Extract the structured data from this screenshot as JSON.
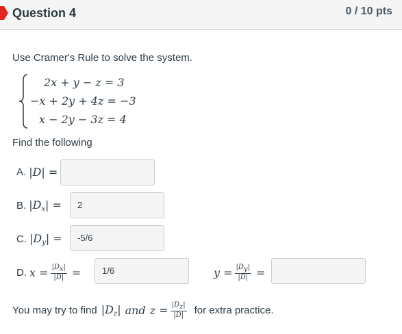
{
  "header": {
    "title": "Question 4",
    "points": "0 / 10 pts"
  },
  "prompt": "Use Cramer's Rule to solve the system.",
  "system": {
    "eq1": "2x + y − z = 3",
    "eq2": "−x + 2y + 4z = −3",
    "eq3": "x − 2y − 3z = 4"
  },
  "find_label": "Find the following",
  "answers": {
    "a": {
      "letter": "A.",
      "value": ""
    },
    "b": {
      "letter": "B.",
      "value": "2"
    },
    "c": {
      "letter": "C.",
      "value": "-5/6"
    },
    "d": {
      "letter": "D.",
      "value": "1/6"
    },
    "y": {
      "value": ""
    }
  },
  "footer": {
    "prefix": "You may try to find",
    "middle": "and",
    "suffix": "for extra practice."
  },
  "colors": {
    "flag": "#e0241f",
    "header_bg": "#f5f5f5",
    "input_bg": "#f5f5f5",
    "border": "#c7cdd1"
  }
}
